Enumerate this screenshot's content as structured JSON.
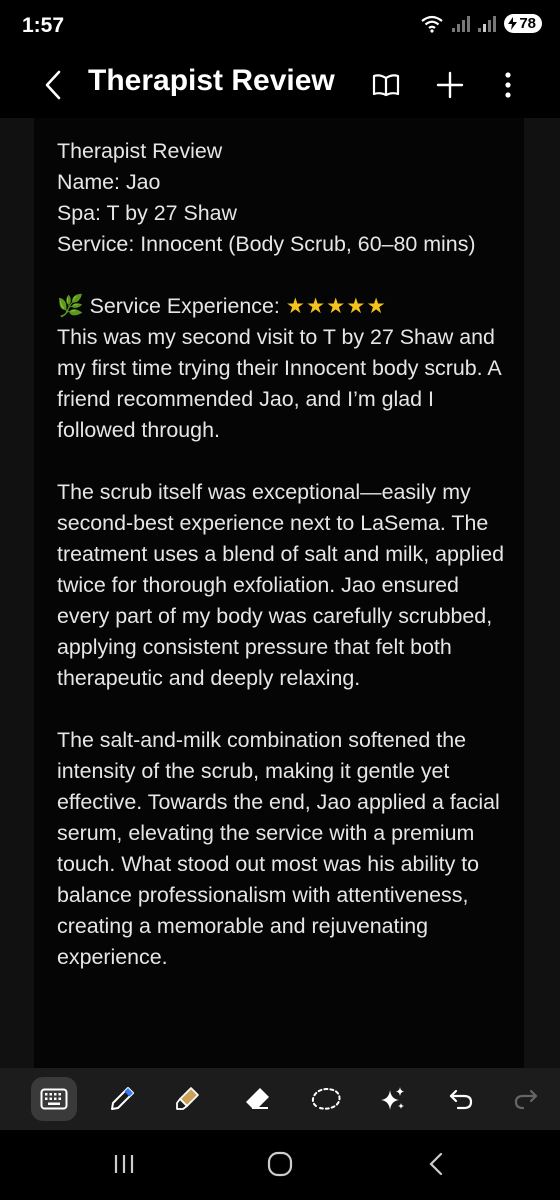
{
  "status": {
    "time": "1:57",
    "battery": "78"
  },
  "app_bar": {
    "title": "Therapist Review"
  },
  "note": {
    "header_lines": [
      "Therapist Review",
      "Name: Jao",
      "Spa: T by 27 Shaw",
      "Service: Innocent (Body Scrub, 60–80 mins)"
    ],
    "experience_emoji": "🌿",
    "experience_label": "Service Experience:",
    "experience_stars": "★★★★★",
    "paragraphs": [
      "This was my second visit to T by 27 Shaw and my first time trying their Innocent body scrub. A friend recommended Jao, and I’m glad I followed through.",
      "The scrub itself was exceptional—easily my second-best experience next to LaSema. The treatment uses a blend of salt and milk, applied twice for thorough exfoliation. Jao ensured every part of my body was carefully scrubbed, applying consistent pressure that felt both therapeutic and deeply relaxing.",
      "The salt-and-milk combination softened the intensity of the scrub, making it gentle yet effective. Towards the end, Jao applied a facial serum, elevating the service with a premium touch. What stood out most was his ability to balance professionalism with attentiveness, creating a memorable and rejuvenating experience."
    ]
  },
  "toolbar": {
    "items": [
      "keyboard-icon",
      "pen-icon",
      "highlighter-icon",
      "eraser-icon",
      "lasso-icon",
      "sparkle-icon",
      "undo-icon",
      "redo-icon"
    ]
  },
  "colors": {
    "background": "#000000",
    "page": "#050505",
    "star": "#f4c21c",
    "pen_accent": "#2f7cf6",
    "highlighter": "#c8a25a"
  }
}
